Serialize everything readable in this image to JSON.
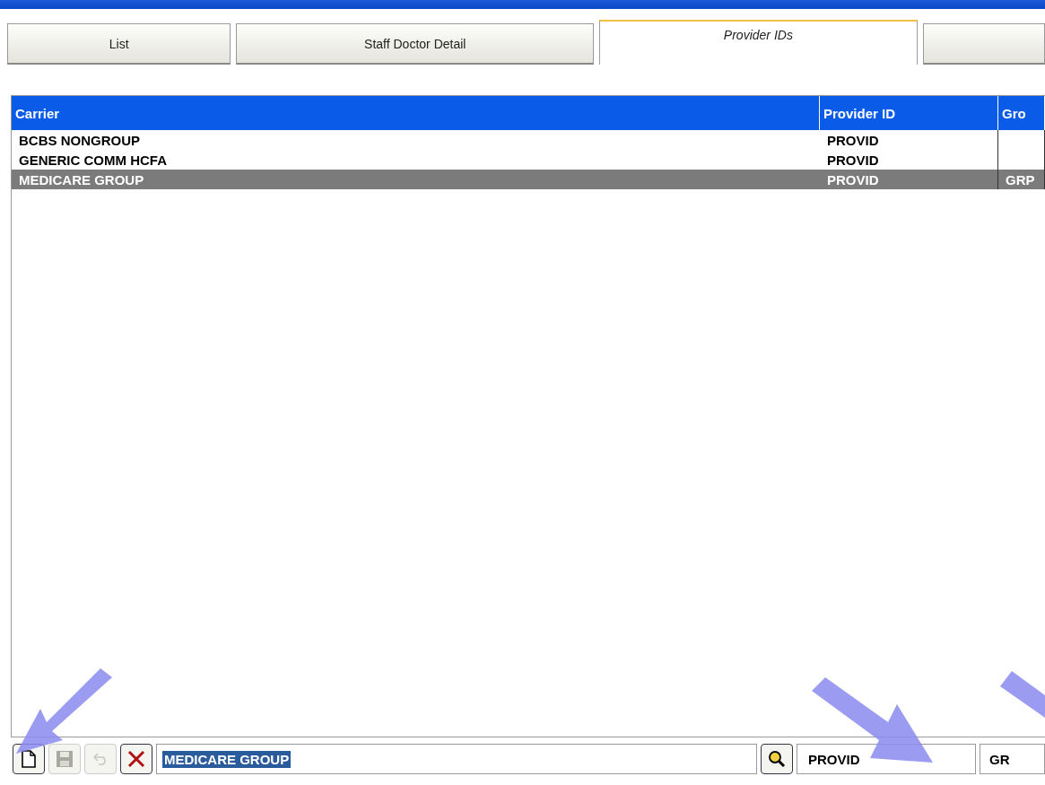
{
  "tabs": [
    {
      "label": "List",
      "selected": false
    },
    {
      "label": "Staff Doctor Detail",
      "selected": false
    },
    {
      "label": "Provider IDs",
      "selected": true
    },
    {
      "selected": false
    }
  ],
  "table": {
    "columns": [
      "Carrier",
      "Provider ID",
      "Gro"
    ],
    "rows": [
      {
        "cells": [
          "BCBS NONGROUP",
          "PROVID",
          ""
        ],
        "selected": false
      },
      {
        "cells": [
          "GENERIC COMM HCFA",
          "PROVID",
          ""
        ],
        "selected": false
      },
      {
        "cells": [
          "MEDICARE GROUP",
          "PROVID",
          "GRP"
        ],
        "selected": true
      }
    ]
  },
  "toolbar": {
    "buttons": [
      {
        "kind": "new",
        "disabled": false
      },
      {
        "kind": "save",
        "disabled": true
      },
      {
        "kind": "undo",
        "disabled": true
      },
      {
        "kind": "delete",
        "disabled": false
      }
    ],
    "carrier_field": "MEDICARE GROUP",
    "provider_id_field": "PROVID",
    "group_field": "GR"
  }
}
